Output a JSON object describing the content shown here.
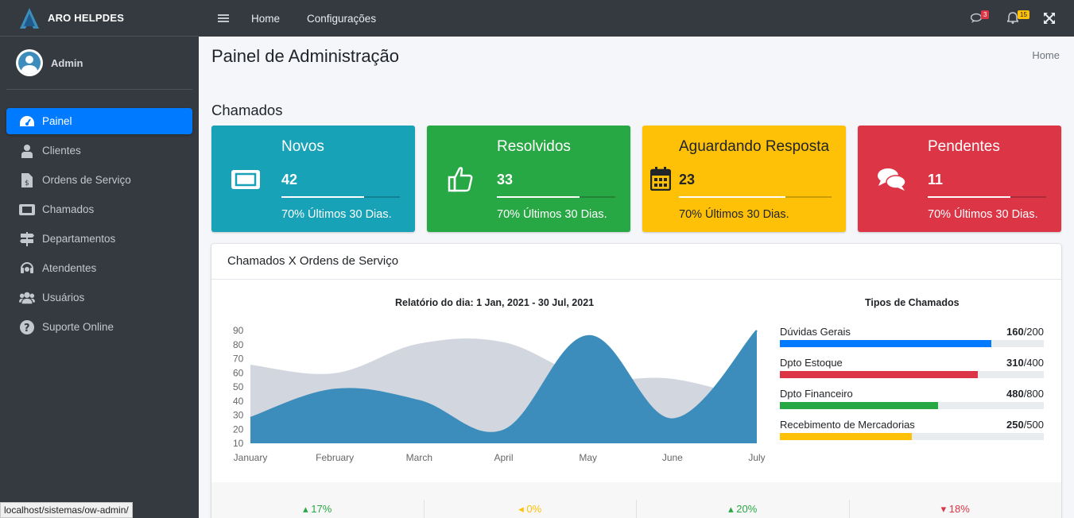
{
  "brand": {
    "name": "ARO HELPDES"
  },
  "user": {
    "name": "Admin"
  },
  "sidebar": {
    "items": [
      {
        "label": "Painel",
        "icon": "tachometer-icon",
        "active": true
      },
      {
        "label": "Clientes",
        "icon": "user-tie-icon"
      },
      {
        "label": "Ordens de Serviço",
        "icon": "file-invoice-dollar-icon"
      },
      {
        "label": "Chamados",
        "icon": "ticket-icon"
      },
      {
        "label": "Departamentos",
        "icon": "signs-icon"
      },
      {
        "label": "Atendentes",
        "icon": "headset-icon"
      },
      {
        "label": "Usuários",
        "icon": "users-icon"
      },
      {
        "label": "Suporte Online",
        "icon": "question-circle-icon"
      }
    ]
  },
  "status_url": "localhost/sistemas/ow-admin/",
  "topnav": {
    "links": [
      "Home",
      "Configurações"
    ],
    "messages_badge": "3",
    "notifications_badge": "15"
  },
  "page": {
    "title": "Painel de Administração",
    "breadcrumb": "Home",
    "section": "Chamados"
  },
  "cards": [
    {
      "title": "Novos",
      "value": "42",
      "desc": "70% Últimos 30 Dias.",
      "color": "#17a2b8",
      "icon": "ticket-icon",
      "progress": 0.7
    },
    {
      "title": "Resolvidos",
      "value": "33",
      "desc": "70% Últimos 30 Dias.",
      "color": "#28a745",
      "icon": "thumbs-up-icon",
      "progress": 0.7
    },
    {
      "title": "Aguardando Resposta",
      "value": "23",
      "desc": "70% Últimos 30 Dias.",
      "color": "#ffc107",
      "icon": "calendar-icon",
      "progress": 0.7
    },
    {
      "title": "Pendentes",
      "value": "11",
      "desc": "70% Últimos 30 Dias.",
      "color": "#dc3545",
      "icon": "comments-icon",
      "progress": 0.7
    }
  ],
  "panel": {
    "title": "Chamados X Ordens de Serviço",
    "chart_title": "Relatório do dia: 1 Jan, 2021 - 30 Jul, 2021",
    "types_title": "Tipos de Chamados"
  },
  "chart_data": {
    "type": "area",
    "title": "Relatório do dia: 1 Jan, 2021 - 30 Jul, 2021",
    "categories": [
      "January",
      "February",
      "March",
      "April",
      "May",
      "June",
      "July"
    ],
    "yticks": [
      10,
      20,
      30,
      40,
      50,
      60,
      70,
      80,
      90
    ],
    "ylim": [
      10,
      90
    ],
    "grid": false,
    "series": [
      {
        "values": [
          65,
          59,
          80,
          81,
          56,
          55,
          40
        ],
        "color": "#d2d6de"
      },
      {
        "values": [
          28,
          48,
          40,
          19,
          86,
          27,
          90
        ],
        "color": "#3c8dbc"
      }
    ]
  },
  "types": [
    {
      "label": "Dúvidas Gerais",
      "value": "160",
      "total": "/200",
      "ratio": 0.8,
      "color": "#007bff"
    },
    {
      "label": "Dpto Estoque",
      "value": "310",
      "total": "/400",
      "ratio": 0.75,
      "color": "#dc3545"
    },
    {
      "label": "Dpto Financeiro",
      "value": "480",
      "total": "/800",
      "ratio": 0.6,
      "color": "#28a745"
    },
    {
      "label": "Recebimento de Mercadorias",
      "value": "250",
      "total": "/500",
      "ratio": 0.5,
      "color": "#ffc107"
    }
  ],
  "footer": [
    {
      "text": "17%",
      "arrow": "up",
      "color": "#28a745"
    },
    {
      "text": "0%",
      "arrow": "left",
      "color": "#ffc107"
    },
    {
      "text": "20%",
      "arrow": "up",
      "color": "#28a745"
    },
    {
      "text": "18%",
      "arrow": "down",
      "color": "#dc3545"
    }
  ]
}
